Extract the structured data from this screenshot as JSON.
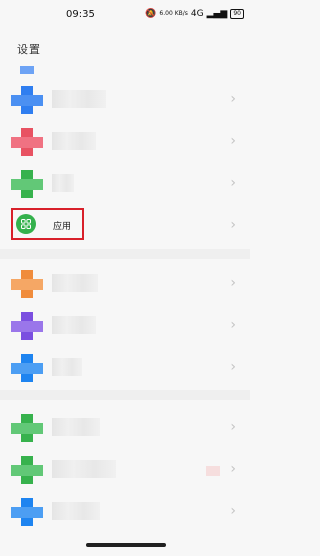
{
  "status_bar": {
    "time": "09:35",
    "net_speed": "6.00 KB/s",
    "network": "4G",
    "battery": "90"
  },
  "header": {
    "title": "设置"
  },
  "rows": [
    {
      "name": "blurred-1",
      "icon_color": "#2f7ef0"
    },
    {
      "name": "blurred-2",
      "icon_color": "#e85262"
    },
    {
      "name": "blurred-3",
      "icon_color": "#37b24d"
    },
    {
      "name": "apps",
      "label": "应用",
      "icon_color": "#34b14c",
      "icon": "grid-icon"
    },
    {
      "name": "blurred-5",
      "icon_color": "#f08c3c"
    },
    {
      "name": "blurred-6",
      "icon_color": "#7b4fe0"
    },
    {
      "name": "blurred-7",
      "icon_color": "#1e84f0"
    },
    {
      "name": "blurred-8",
      "icon_color": "#37b24d"
    },
    {
      "name": "blurred-9",
      "icon_color": "#37b24d"
    },
    {
      "name": "blurred-10",
      "icon_color": "#1e84f0"
    }
  ],
  "colors": {
    "highlight": "#d8202a",
    "accent_green": "#34b14c"
  }
}
